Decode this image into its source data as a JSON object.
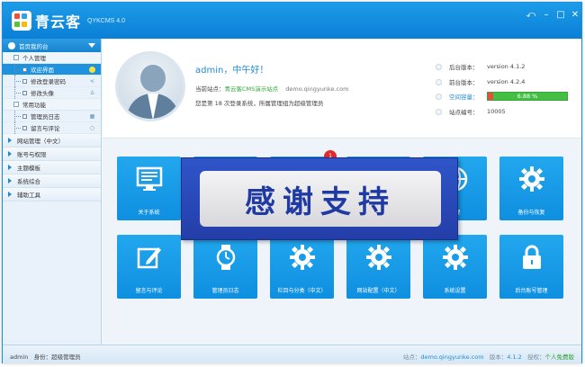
{
  "app": {
    "brand": "青云客",
    "version": "QYKCMS 4.0",
    "colors": {
      "accent": "#1b8fdc",
      "tile": "#19a0ea",
      "overlay": "#2a4bbb",
      "badge": "#e02a2a"
    }
  },
  "titlebar": {
    "controls": [
      "back-icon",
      "minimize-icon",
      "maximize-icon",
      "close-icon"
    ]
  },
  "sidebar": {
    "header": "首页我的台",
    "groups": [
      {
        "label": "个人管理",
        "items": [
          {
            "label": "欢迎界面",
            "active": true,
            "icon": "circle-icon"
          },
          {
            "label": "修改登录密码",
            "active": false,
            "icon": "share-icon"
          },
          {
            "label": "修改头像",
            "active": false,
            "icon": "person-icon"
          }
        ]
      },
      {
        "label": "常用功能",
        "items": [
          {
            "label": "管理员日志",
            "active": false,
            "icon": "grid-icon"
          },
          {
            "label": "留言与评论",
            "active": false,
            "icon": "chat-icon"
          }
        ]
      }
    ],
    "sections": [
      "网站管理（中文）",
      "账号与权限",
      "主题模板",
      "系统综合",
      "辅助工具"
    ]
  },
  "welcome": {
    "greeting": "admin，中午好！",
    "site_label": "当前站点：",
    "site_name": "青云客CMS演示站点",
    "site_url": "demo.qingyunke.com",
    "login_text": "您是第 18 次登录系统，所属管理组为超级管理员"
  },
  "stats": [
    {
      "label": "后台版本：",
      "value": "version 4.1.2"
    },
    {
      "label": "前台版本：",
      "value": "version 4.2.4"
    },
    {
      "label": "空间容量：",
      "value": "6.88 %",
      "progress": 0.0688
    },
    {
      "label": "站点编号：",
      "value": "10005"
    }
  ],
  "tiles": [
    {
      "label": "关于系统",
      "icon": "monitor-icon"
    },
    {
      "label": "",
      "icon": ""
    },
    {
      "label": "",
      "icon": ""
    },
    {
      "label": "",
      "icon": ""
    },
    {
      "label": "管理",
      "icon": "globe-icon"
    },
    {
      "label": "备份与恢复",
      "icon": "gear-icon"
    },
    {
      "label": "留言与评论",
      "icon": "edit-icon"
    },
    {
      "label": "管理员日志",
      "icon": "watch-icon"
    },
    {
      "label": "栏目与分类（中文）",
      "icon": "gear-icon"
    },
    {
      "label": "网站配置（中文）",
      "icon": "gear-icon"
    },
    {
      "label": "系统设置",
      "icon": "gear-icon"
    },
    {
      "label": "后台账号管理",
      "icon": "lock-icon"
    }
  ],
  "badge": "1",
  "overlay": {
    "text": "感谢支持"
  },
  "statusbar": {
    "user": "admin",
    "role_label": "身份：",
    "role": "超级管理员",
    "site_label": "站点：",
    "site_url": "demo.qingyunke.com",
    "version_label": "版本：",
    "version": "4.1.2",
    "license_label": "授权：",
    "license": "个人免费版"
  }
}
